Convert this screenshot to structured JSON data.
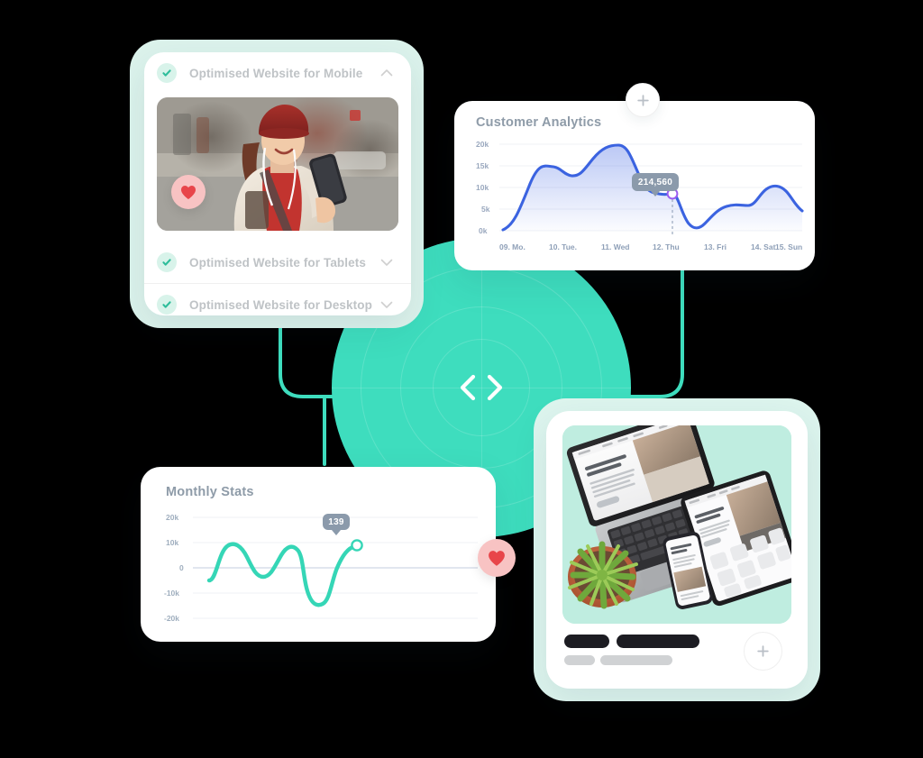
{
  "theme": {
    "teal": "#3EDDBE",
    "mint_frame": "#DCF3EC",
    "card_white": "#FFFFFF",
    "blue_line": "#3B63E0",
    "teal_line": "#35D6B6",
    "tooltip_bg": "#8B9AAB",
    "heart_pink": "#F8C3C3",
    "heart_red": "#E8454A",
    "label_gray": "#BFC3C6",
    "title_gray": "#8E9BA8"
  },
  "accordion": {
    "items": [
      {
        "label": "Optimised Website for Mobile",
        "check_icon": "check-icon",
        "chevron": "chevron-up-icon",
        "expanded": true
      },
      {
        "label": "Optimised Website for Tablets",
        "check_icon": "check-icon",
        "chevron": "chevron-down-icon",
        "expanded": false
      },
      {
        "label": "Optimised Website for Desktop",
        "check_icon": "check-icon",
        "chevron": "chevron-down-icon",
        "expanded": false
      }
    ],
    "photo_alt": "woman-with-phone-photo",
    "like_button": {
      "icon": "heart-icon"
    }
  },
  "analytics": {
    "title": "Customer Analytics",
    "add_button": {
      "icon": "plus-icon"
    },
    "tooltip_value": "214,560"
  },
  "monthly": {
    "title": "Monthly Stats",
    "tooltip_value": "139",
    "like_button": {
      "icon": "heart-icon"
    }
  },
  "device_card": {
    "photo_alt": "laptop-tablet-phone-mockup-photo",
    "add_button": {
      "icon": "plus-icon"
    },
    "skeleton_lines": 4
  },
  "hub": {
    "icon": "code-icon"
  },
  "chart_data": [
    {
      "type": "area",
      "id": "customer-analytics",
      "title": "Customer Analytics",
      "xlabel": "",
      "ylabel": "",
      "ylim": [
        0,
        20000
      ],
      "ytick_labels": [
        "20k",
        "15k",
        "10k",
        "5k",
        "0k"
      ],
      "ytick_values": [
        20000,
        15000,
        10000,
        5000,
        0
      ],
      "categories": [
        "09. Mo.",
        "10. Tue.",
        "11. Wed",
        "12. Thu",
        "13. Fri",
        "14. Sat",
        "15. Sun"
      ],
      "grid": true,
      "legend": "none",
      "line_color": "#3B63E0",
      "fill": "gradient-blue-to-transparent",
      "annotation": {
        "label": "214,560",
        "at_category": "12. Thu",
        "value": 8500,
        "marker": "hollow-circle-purple",
        "guide": "dashed-vertical"
      },
      "x": [
        0,
        0.35,
        0.7,
        1.0,
        1.35,
        1.7,
        2.0,
        2.35,
        2.7,
        3.0,
        3.2,
        3.5,
        3.8,
        4.0,
        4.4,
        4.8,
        5.2,
        5.6,
        6.0
      ],
      "values": [
        600,
        6000,
        14900,
        13300,
        15000,
        18500,
        19300,
        14000,
        9000,
        8500,
        8700,
        2500,
        1500,
        3500,
        5000,
        4500,
        8200,
        7600,
        4800
      ]
    },
    {
      "type": "line",
      "id": "monthly-stats",
      "title": "Monthly Stats",
      "xlabel": "",
      "ylabel": "",
      "ylim": [
        -20000,
        20000
      ],
      "ytick_labels": [
        "20k",
        "10k",
        "0",
        "-10k",
        "-20k"
      ],
      "ytick_values": [
        20000,
        10000,
        0,
        -10000,
        -20000
      ],
      "grid": true,
      "legend": "none",
      "line_color": "#35D6B6",
      "annotation": {
        "label": "139",
        "value": 12500,
        "marker": "hollow-circle-teal"
      },
      "x": [
        0,
        0.5,
        1.0,
        1.5,
        2.0,
        2.5,
        3.0,
        3.5,
        4.0,
        4.4
      ],
      "values": [
        -5000,
        2000,
        8500,
        -1000,
        -3000,
        8000,
        7500,
        -13500,
        4000,
        12500
      ]
    }
  ]
}
